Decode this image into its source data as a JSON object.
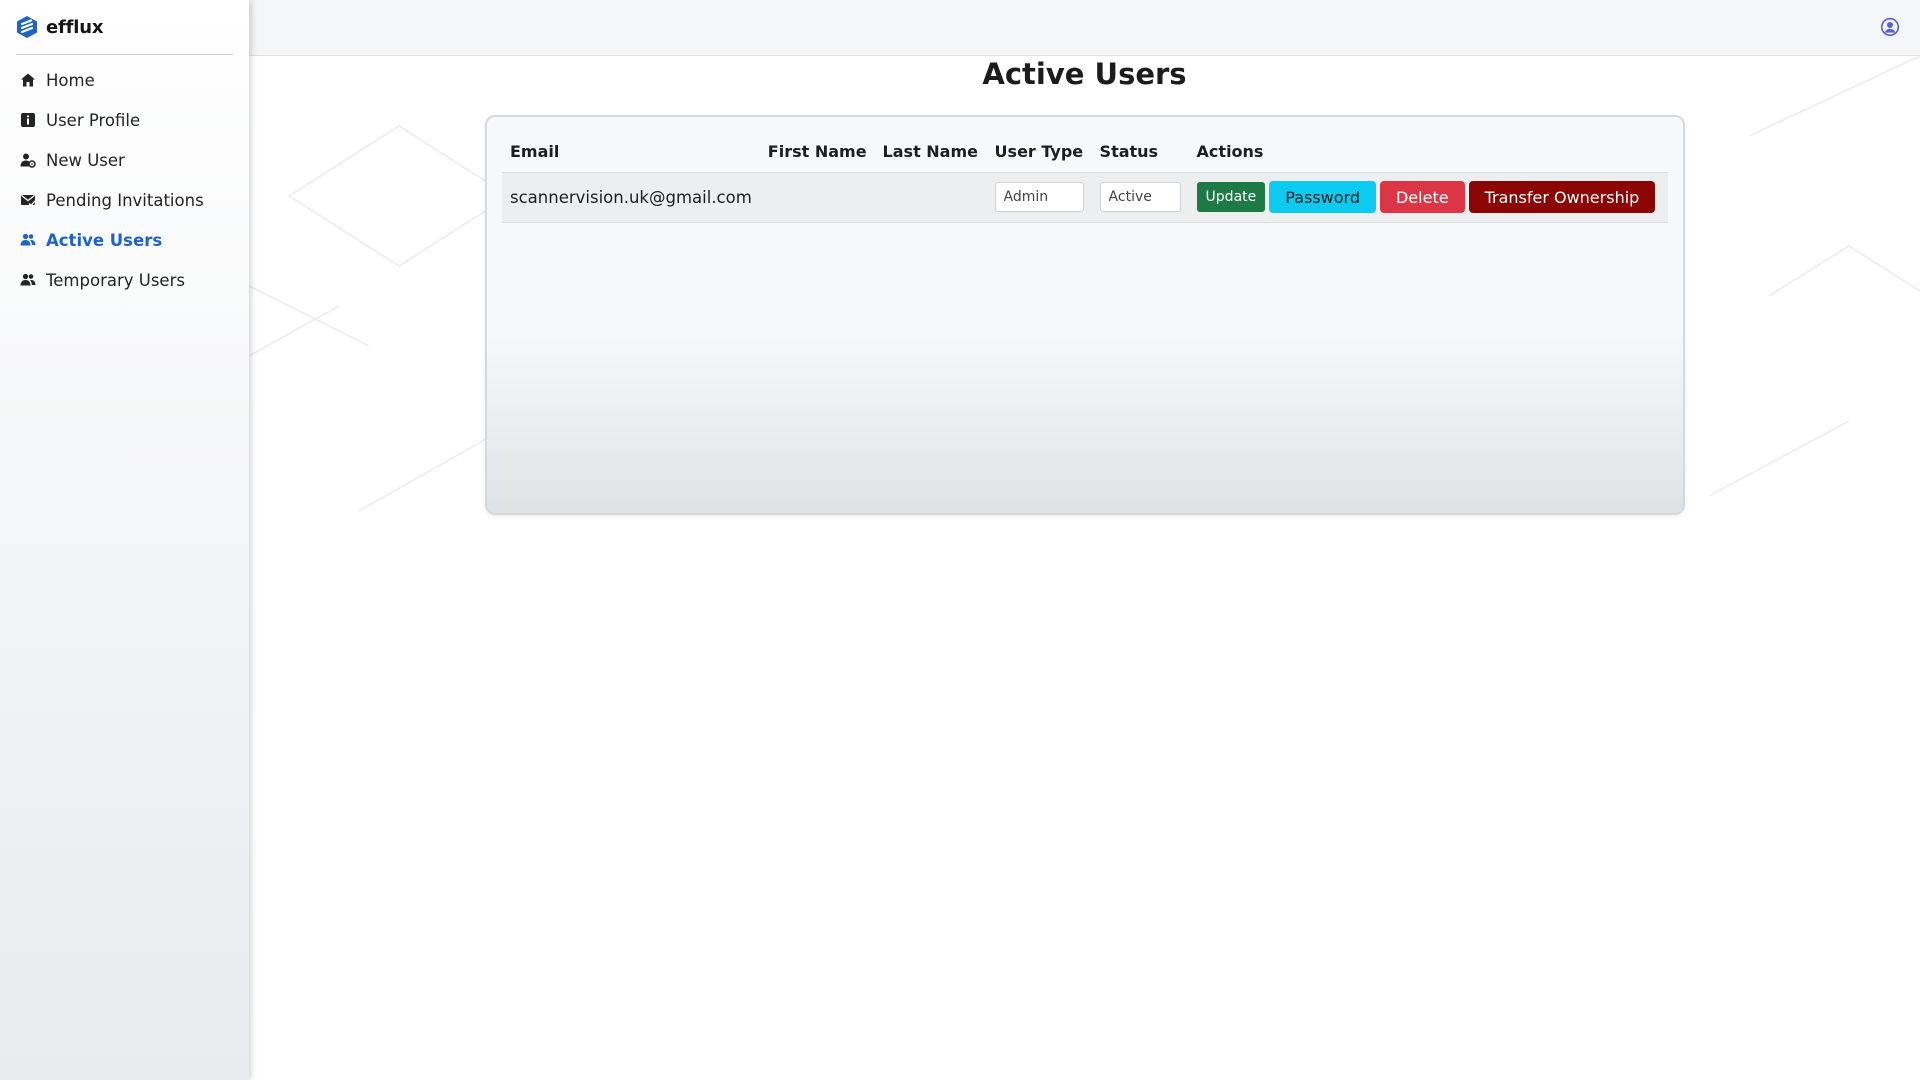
{
  "app": {
    "brand_name": "efflux"
  },
  "sidebar": {
    "items": [
      {
        "label": "Home",
        "icon": "home-icon"
      },
      {
        "label": "User Profile",
        "icon": "info-icon"
      },
      {
        "label": "New User",
        "icon": "user-gear-icon"
      },
      {
        "label": "Pending Invitations",
        "icon": "envelope-icon"
      },
      {
        "label": "Active Users",
        "icon": "users-icon",
        "active": true
      },
      {
        "label": "Temporary Users",
        "icon": "users-icon"
      }
    ]
  },
  "header": {
    "user_icon": "user-circle-icon"
  },
  "main": {
    "title": "Active Users",
    "table": {
      "columns": [
        "Email",
        "First Name",
        "Last Name",
        "User Type",
        "Status",
        "Actions"
      ],
      "rows": [
        {
          "email": "scannervision.uk@gmail.com",
          "first_name": "",
          "last_name": "",
          "user_type": "Admin",
          "status": "Active",
          "actions": [
            "Update",
            "Password",
            "Delete",
            "Transfer Ownership"
          ]
        }
      ]
    }
  },
  "colors": {
    "accent": "#1f63c6",
    "update": "#1d7a44",
    "password": "#0dcaf0",
    "delete": "#dc3545",
    "transfer": "#8b0505"
  }
}
